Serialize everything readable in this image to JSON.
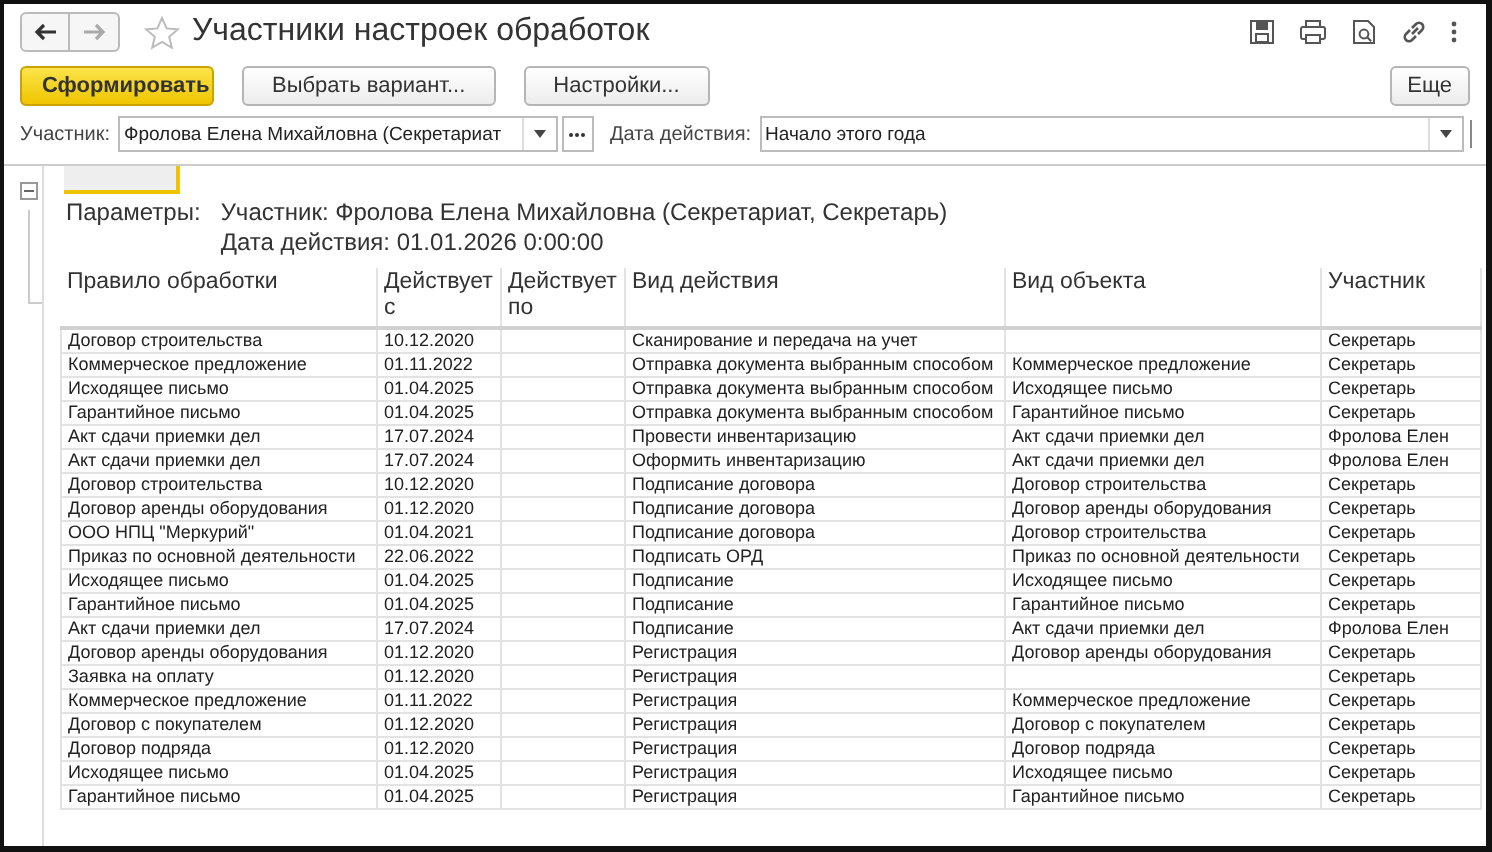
{
  "window": {
    "title": "Участники настроек обработок"
  },
  "command_bar": {
    "buttons": [
      {
        "label": "Сформировать",
        "kind": "primary"
      },
      {
        "label": "Выбрать вариант...",
        "kind": "normal"
      },
      {
        "label": "Настройки...",
        "kind": "normal"
      }
    ],
    "more": "Еще"
  },
  "filters": [
    {
      "label": "Участник:",
      "value": "Фролова Елена Михайловна (Секретариат",
      "kind": "choice"
    },
    {
      "label": "Дата действия:",
      "value": "Начало этого года",
      "kind": "wide"
    }
  ],
  "report": {
    "params_label": "Параметры:",
    "params": [
      "Участник: Фролова Елена Михайловна (Секретариат, Секретарь)",
      "Дата действия: 01.01.2026 0:00:00"
    ],
    "columns": [
      "Правило обработки",
      "Действует с",
      "Действует по",
      "Вид действия",
      "Вид объекта",
      "Участник"
    ],
    "rows": [
      {
        "rule": "Договор строительства",
        "from": "10.12.2020",
        "action": "Сканирование и передача на учет",
        "participant": "Секретарь"
      },
      {
        "rule": "Коммерческое предложение",
        "from": "01.11.2022",
        "action": "Отправка документа выбранным способом",
        "object": "Коммерческое предложение",
        "participant": "Секретарь"
      },
      {
        "rule": "Исходящее письмо",
        "from": "01.04.2025",
        "action": "Отправка документа выбранным способом",
        "object": "Исходящее письмо",
        "participant": "Секретарь"
      },
      {
        "rule": "Гарантийное письмо",
        "from": "01.04.2025",
        "action": "Отправка документа выбранным способом",
        "object": "Гарантийное письмо",
        "participant": "Секретарь"
      },
      {
        "rule": "Акт сдачи приемки дел",
        "from": "17.07.2024",
        "action": "Провести инвентаризацию",
        "object": "Акт сдачи приемки дел",
        "participant": "Фролова Елен"
      },
      {
        "rule": "Акт сдачи приемки дел",
        "from": "17.07.2024",
        "action": "Оформить инвентаризацию",
        "object": "Акт сдачи приемки дел",
        "participant": "Фролова Елен"
      },
      {
        "rule": "Договор строительства",
        "from": "10.12.2020",
        "action": "Подписание договора",
        "object": "Договор строительства",
        "participant": "Секретарь"
      },
      {
        "rule": "Договор аренды оборудования",
        "from": "01.12.2020",
        "action": "Подписание договора",
        "object": "Договор аренды оборудования",
        "participant": "Секретарь"
      },
      {
        "rule": "ООО НПЦ \"Меркурий\"",
        "from": "01.04.2021",
        "action": "Подписание договора",
        "object": "Договор строительства",
        "participant": "Секретарь"
      },
      {
        "rule": "Приказ по основной деятельности",
        "from": "22.06.2022",
        "action": "Подписать ОРД",
        "object": "Приказ по основной деятельности",
        "participant": "Секретарь"
      },
      {
        "rule": "Исходящее письмо",
        "from": "01.04.2025",
        "action": "Подписание",
        "object": "Исходящее письмо",
        "participant": "Секретарь"
      },
      {
        "rule": "Гарантийное письмо",
        "from": "01.04.2025",
        "action": "Подписание",
        "object": "Гарантийное письмо",
        "participant": "Секретарь"
      },
      {
        "rule": "Акт сдачи приемки дел",
        "from": "17.07.2024",
        "action": "Подписание",
        "object": "Акт сдачи приемки дел",
        "participant": "Фролова Елен"
      },
      {
        "rule": "Договор аренды оборудования",
        "from": "01.12.2020",
        "action": "Регистрация",
        "object": "Договор аренды оборудования",
        "participant": "Секретарь"
      },
      {
        "rule": "Заявка на оплату",
        "from": "01.12.2020",
        "action": "Регистрация",
        "participant": "Секретарь"
      },
      {
        "rule": "Коммерческое предложение",
        "from": "01.11.2022",
        "action": "Регистрация",
        "object": "Коммерческое предложение",
        "participant": "Секретарь"
      },
      {
        "rule": "Договор с покупателем",
        "from": "01.12.2020",
        "action": "Регистрация",
        "object": "Договор с покупателем",
        "participant": "Секретарь"
      },
      {
        "rule": "Договор подряда",
        "from": "01.12.2020",
        "action": "Регистрация",
        "object": "Договор подряда",
        "participant": "Секретарь"
      },
      {
        "rule": "Исходящее письмо",
        "from": "01.04.2025",
        "action": "Регистрация",
        "object": "Исходящее письмо",
        "participant": "Секретарь"
      },
      {
        "rule": "Гарантийное письмо",
        "from": "01.04.2025",
        "action": "Регистрация",
        "object": "Гарантийное письмо",
        "participant": "Секретарь"
      }
    ]
  }
}
